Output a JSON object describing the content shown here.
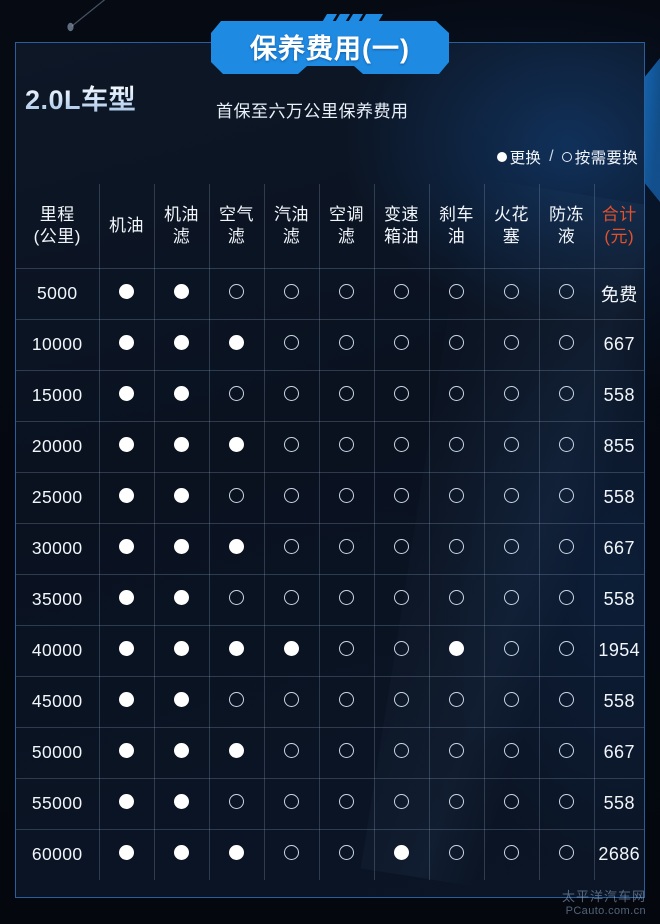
{
  "header": {
    "model_title": "2.0L车型",
    "subtitle": "首保至六万公里保养费用",
    "banner_title": "保养费用(一)",
    "legend": {
      "replace_label": "更换",
      "separator": "/",
      "as_needed_label": "按需要换"
    }
  },
  "watermark": {
    "cn": "太平洋汽车网",
    "en": "PCauto.com.cn"
  },
  "colors": {
    "accent_blue": "#1f8ae2",
    "total_orange": "#e0512c",
    "panel_border": "#2a5f9e",
    "panel_bg": "#0b1422",
    "page_bg": "#04070e",
    "text": "#f2f6fb"
  },
  "table": {
    "columns": [
      "里程\n(公里)",
      "机油",
      "机油\n滤",
      "空气\n滤",
      "汽油\n滤",
      "空调\n滤",
      "变速\n箱油",
      "刹车\n油",
      "火花\n塞",
      "防冻\n液",
      "合计\n(元)"
    ],
    "columns_flat": [
      "里程(公里)",
      "机油",
      "机油滤",
      "空气滤",
      "汽油滤",
      "空调滤",
      "变速箱油",
      "刹车油",
      "火花塞",
      "防冻液",
      "合计(元)"
    ],
    "legend_symbols": {
      "solid": "●",
      "hollow": "○"
    },
    "rows": [
      {
        "km": "5000",
        "marks": [
          1,
          1,
          0,
          0,
          0,
          0,
          0,
          0,
          0
        ],
        "total": "免费"
      },
      {
        "km": "10000",
        "marks": [
          1,
          1,
          1,
          0,
          0,
          0,
          0,
          0,
          0
        ],
        "total": "667"
      },
      {
        "km": "15000",
        "marks": [
          1,
          1,
          0,
          0,
          0,
          0,
          0,
          0,
          0
        ],
        "total": "558"
      },
      {
        "km": "20000",
        "marks": [
          1,
          1,
          1,
          0,
          0,
          0,
          0,
          0,
          0
        ],
        "total": "855"
      },
      {
        "km": "25000",
        "marks": [
          1,
          1,
          0,
          0,
          0,
          0,
          0,
          0,
          0
        ],
        "total": "558"
      },
      {
        "km": "30000",
        "marks": [
          1,
          1,
          1,
          0,
          0,
          0,
          0,
          0,
          0
        ],
        "total": "667"
      },
      {
        "km": "35000",
        "marks": [
          1,
          1,
          0,
          0,
          0,
          0,
          0,
          0,
          0
        ],
        "total": "558"
      },
      {
        "km": "40000",
        "marks": [
          1,
          1,
          1,
          1,
          0,
          0,
          1,
          0,
          0
        ],
        "total": "1954"
      },
      {
        "km": "45000",
        "marks": [
          1,
          1,
          0,
          0,
          0,
          0,
          0,
          0,
          0
        ],
        "total": "558"
      },
      {
        "km": "50000",
        "marks": [
          1,
          1,
          1,
          0,
          0,
          0,
          0,
          0,
          0
        ],
        "total": "667"
      },
      {
        "km": "55000",
        "marks": [
          1,
          1,
          0,
          0,
          0,
          0,
          0,
          0,
          0
        ],
        "total": "558"
      },
      {
        "km": "60000",
        "marks": [
          1,
          1,
          1,
          0,
          0,
          1,
          0,
          0,
          0
        ],
        "total": "2686"
      }
    ]
  }
}
